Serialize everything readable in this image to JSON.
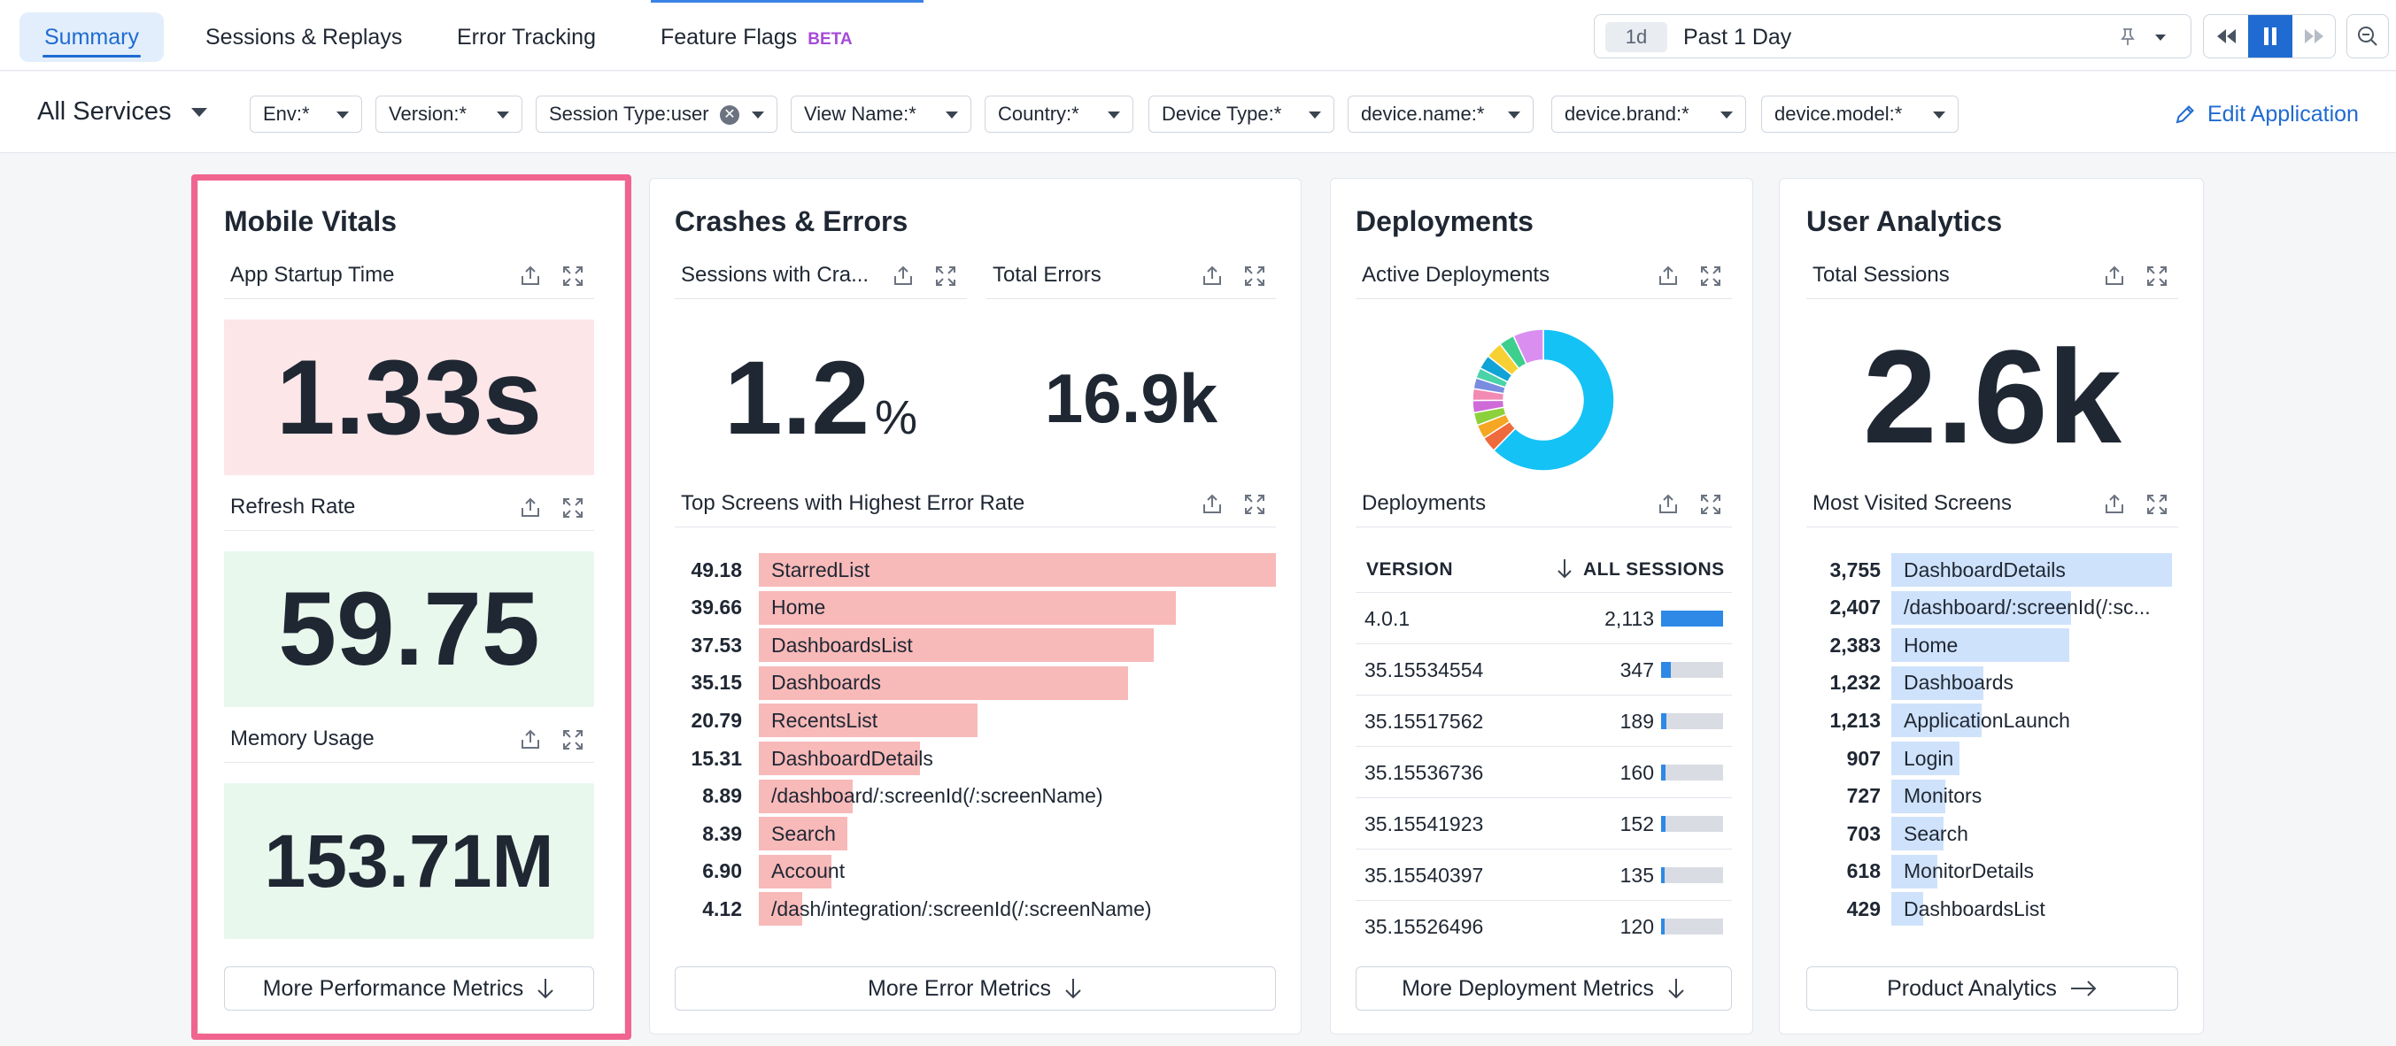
{
  "nav": {
    "tabs": [
      {
        "label": "Summary"
      },
      {
        "label": "Sessions & Replays"
      },
      {
        "label": "Error Tracking"
      },
      {
        "label": "Feature Flags",
        "badge": "BETA"
      }
    ],
    "time": {
      "chip": "1d",
      "label": "Past 1 Day"
    }
  },
  "filters": {
    "services": "All Services",
    "items": [
      "Env:*",
      "Version:*",
      "Session Type:user",
      "View Name:*",
      "Country:*",
      "Device Type:*",
      "device.name:*",
      "device.brand:*",
      "device.model:*"
    ],
    "edit_label": "Edit Application"
  },
  "mobile_vitals": {
    "title": "Mobile Vitals",
    "startup": {
      "label": "App Startup Time",
      "value": "1.33s"
    },
    "refresh": {
      "label": "Refresh Rate",
      "value": "59.75"
    },
    "memory": {
      "label": "Memory Usage",
      "value": "153.71M"
    },
    "more": "More Performance Metrics"
  },
  "crashes": {
    "title": "Crashes & Errors",
    "sessions_label": "Sessions with Cra...",
    "sessions_value": "1.2",
    "sessions_unit": "%",
    "total_label": "Total Errors",
    "total_value": "16.9k",
    "top_label": "Top Screens with Highest Error Rate",
    "rows": [
      {
        "value": "49.18",
        "label": "StarredList",
        "pct": 49.18
      },
      {
        "value": "39.66",
        "label": "Home",
        "pct": 39.66
      },
      {
        "value": "37.53",
        "label": "DashboardsList",
        "pct": 37.53
      },
      {
        "value": "35.15",
        "label": "Dashboards",
        "pct": 35.15
      },
      {
        "value": "20.79",
        "label": "RecentsList",
        "pct": 20.79
      },
      {
        "value": "15.31",
        "label": "DashboardDetails",
        "pct": 15.31
      },
      {
        "value": "8.89",
        "label": "/dashboard/:screenId(/:screenName)",
        "pct": 8.89
      },
      {
        "value": "8.39",
        "label": "Search",
        "pct": 8.39
      },
      {
        "value": "6.90",
        "label": "Account",
        "pct": 6.9
      },
      {
        "value": "4.12",
        "label": "/dash/integration/:screenId(/:screenName)",
        "pct": 4.12
      }
    ],
    "more": "More Error Metrics"
  },
  "deployments": {
    "title": "Deployments",
    "active_label": "Active Deployments",
    "table_label": "Deployments",
    "col_version": "VERSION",
    "col_sessions": "ALL SESSIONS",
    "rows": [
      {
        "version": "4.0.1",
        "sessions": "2,113",
        "n": 2113
      },
      {
        "version": "35.15534554",
        "sessions": "347",
        "n": 347
      },
      {
        "version": "35.15517562",
        "sessions": "189",
        "n": 189
      },
      {
        "version": "35.15536736",
        "sessions": "160",
        "n": 160
      },
      {
        "version": "35.15541923",
        "sessions": "152",
        "n": 152
      },
      {
        "version": "35.15540397",
        "sessions": "135",
        "n": 135
      },
      {
        "version": "35.15526496",
        "sessions": "120",
        "n": 120
      }
    ],
    "donut": [
      {
        "n": 2113,
        "color": "#14c2f5"
      },
      {
        "n": 120,
        "color": "#ef6a3c"
      },
      {
        "n": 110,
        "color": "#f5a623"
      },
      {
        "n": 100,
        "color": "#8bd13c"
      },
      {
        "n": 95,
        "color": "#cf6ad9"
      },
      {
        "n": 90,
        "color": "#f28ab4"
      },
      {
        "n": 85,
        "color": "#7a8ce0"
      },
      {
        "n": 80,
        "color": "#4ad3a8"
      },
      {
        "n": 110,
        "color": "#0fa3d6"
      },
      {
        "n": 130,
        "color": "#f7d133"
      },
      {
        "n": 120,
        "color": "#3ecf8e"
      },
      {
        "n": 235,
        "color": "#d98ef0"
      }
    ],
    "more": "More Deployment Metrics"
  },
  "user_analytics": {
    "title": "User Analytics",
    "total_label": "Total Sessions",
    "total_value": "2.6k",
    "visited_label": "Most Visited Screens",
    "rows": [
      {
        "value": "3,755",
        "label": "DashboardDetails",
        "n": 3755
      },
      {
        "value": "2,407",
        "label": "/dashboard/:screenId(/:sc...",
        "n": 2407
      },
      {
        "value": "2,383",
        "label": "Home",
        "n": 2383
      },
      {
        "value": "1,232",
        "label": "Dashboards",
        "n": 1232
      },
      {
        "value": "1,213",
        "label": "ApplicationLaunch",
        "n": 1213
      },
      {
        "value": "907",
        "label": "Login",
        "n": 907
      },
      {
        "value": "727",
        "label": "Monitors",
        "n": 727
      },
      {
        "value": "703",
        "label": "Search",
        "n": 703
      },
      {
        "value": "618",
        "label": "MonitorDetails",
        "n": 618
      },
      {
        "value": "429",
        "label": "DashboardsList",
        "n": 429
      }
    ],
    "more": "Product Analytics"
  }
}
